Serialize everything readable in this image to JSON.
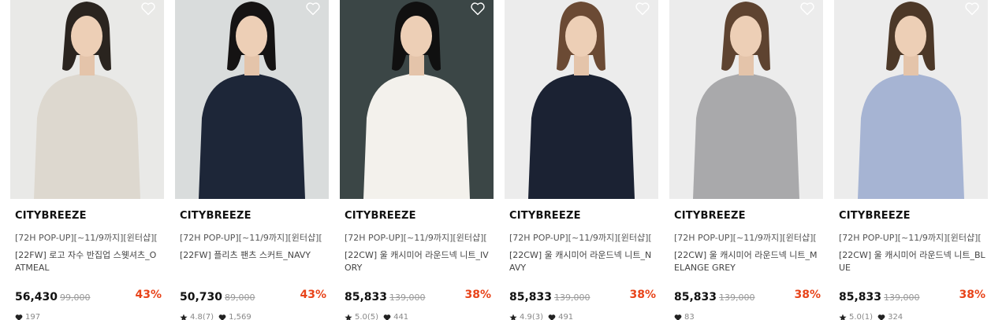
{
  "products": [
    {
      "brand": "CITYBREEZE",
      "promo": "[72H POP-UP][~11/9까지][윈터샵][",
      "title": "[22FW] 로고 자수 반집업 스웻셔츠_OATMEAL",
      "price": "56,430",
      "original_price": "99,000",
      "discount": "43%",
      "rating": "",
      "likes": "197",
      "bg": "#e9e9e7",
      "garment": "#ddd8cf",
      "hair": "#2a241f",
      "bottom": "#6d88a8",
      "rating_shown": false
    },
    {
      "brand": "CITYBREEZE",
      "promo": "[72H POP-UP][~11/9까지][윈터샵][",
      "title": "[22FW] 플리츠 팬츠 스커트_NAVY",
      "price": "50,730",
      "original_price": "89,000",
      "discount": "43%",
      "rating": "4.8(7)",
      "likes": "1,569",
      "bg": "#d9dcdc",
      "garment": "#1d2638",
      "hair": "#151313",
      "bottom": "#1c2436",
      "rating_shown": true
    },
    {
      "brand": "CITYBREEZE",
      "promo": "[72H POP-UP][~11/9까지][윈터샵][",
      "title": "[22CW] 울 캐시미어 라운드넥 니트_IVORY",
      "price": "85,833",
      "original_price": "139,000",
      "discount": "38%",
      "rating": "5.0(5)",
      "likes": "441",
      "bg": "#3b4646",
      "garment": "#f3f1ec",
      "hair": "#101010",
      "bottom": "#6c8cae",
      "rating_shown": true
    },
    {
      "brand": "CITYBREEZE",
      "promo": "[72H POP-UP][~11/9까지][윈터샵][",
      "title": "[22CW] 울 캐시미어 라운드넥 니트_NAVY",
      "price": "85,833",
      "original_price": "139,000",
      "discount": "38%",
      "rating": "4.9(3)",
      "likes": "491",
      "bg": "#ececec",
      "garment": "#1b2233",
      "hair": "#6b4a34",
      "bottom": "#5a7390",
      "rating_shown": true
    },
    {
      "brand": "CITYBREEZE",
      "promo": "[72H POP-UP][~11/9까지][윈터샵][",
      "title": "[22CW] 울 캐시미어 라운드넥 니트_MELANGE GREY",
      "price": "85,833",
      "original_price": "139,000",
      "discount": "38%",
      "rating": "",
      "likes": "83",
      "bg": "#ececec",
      "garment": "#a9a9ab",
      "hair": "#5e4330",
      "bottom": "#9a9a9c",
      "rating_shown": false
    },
    {
      "brand": "CITYBREEZE",
      "promo": "[72H POP-UP][~11/9까지][윈터샵][",
      "title": "[22CW] 울 캐시미어 라운드넥 니트_BLUE",
      "price": "85,833",
      "original_price": "139,000",
      "discount": "38%",
      "rating": "5.0(1)",
      "likes": "324",
      "bg": "#ececec",
      "garment": "#a6b4d3",
      "hair": "#4c3828",
      "bottom": "#1a1a1a",
      "rating_shown": true
    }
  ],
  "colors": {
    "discount": "#e8441a",
    "brand_text": "#111111",
    "muted_text": "#888888"
  },
  "icons": {
    "wishlist": "heart-outline-icon",
    "rating": "star-icon",
    "likes": "heart-filled-icon"
  }
}
